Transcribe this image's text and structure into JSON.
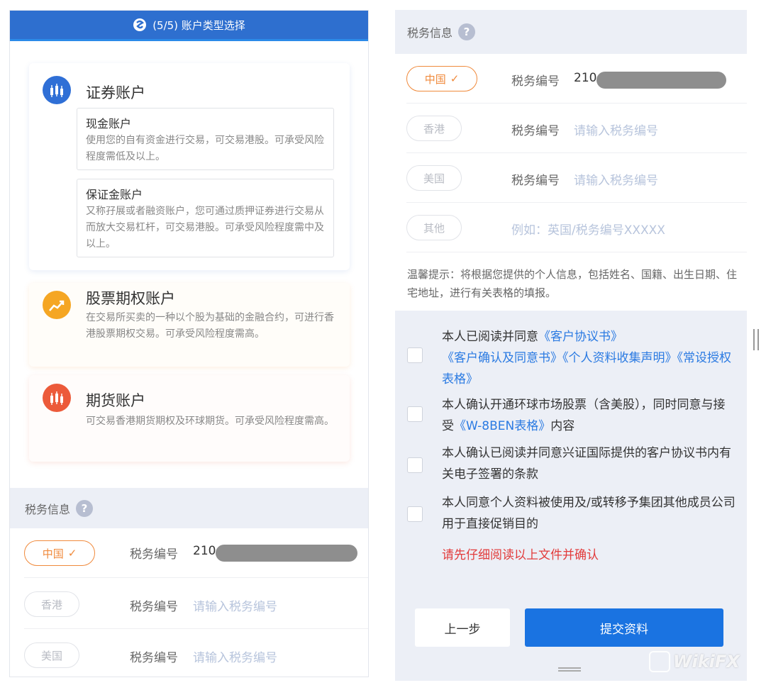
{
  "header": {
    "title": "(5/5) 账户类型选择"
  },
  "accounts": {
    "securities": {
      "title": "证券账户",
      "cash": {
        "title": "现金账户",
        "desc": "使用您的自有资金进行交易，可交易港股。可承受风险程度需低及以上。"
      },
      "margin": {
        "title": "保证金账户",
        "desc": "又称孖展或者融资账户，您可通过质押证券进行交易从而放大交易杠杆，可交易港股。可承受风险程度需中及以上。"
      }
    },
    "options": {
      "title": "股票期权账户",
      "desc": "在交易所买卖的一种以个股为基础的金融合约，可进行香港股票期权交易。可承受风险程度需高。"
    },
    "futures": {
      "title": "期货账户",
      "desc": "可交易香港期货期权及环球期货。可承受风险程度需高。"
    }
  },
  "tax": {
    "section_title": "税务信息",
    "help_symbol": "?",
    "field_label": "税务编号",
    "rows": [
      {
        "region": "中国",
        "check": "✓",
        "value": "210"
      },
      {
        "region": "香港",
        "placeholder": "请输入税务编号"
      },
      {
        "region": "美国",
        "placeholder": "请输入税务编号"
      },
      {
        "region": "其他",
        "placeholder": "例如：英国/税务编号XXXXX"
      }
    ],
    "notice": "温馨提示：将根据您提供的个人信息，包括姓名、国籍、出生日期、住宅地址，进行有关表格的填报。"
  },
  "agreements": {
    "item1": {
      "prefix": "本人已阅读并同意",
      "link1": "《客户协议书》",
      "link2": "《客户确认及同意书》",
      "link3": "《个人资料收集声明》",
      "link4": "《常设授权表格》"
    },
    "item2": {
      "prefix": "本人确认开通环球市场股票（含美股），同时同意与接受",
      "link": "《W-8BEN表格》",
      "suffix": "内容"
    },
    "item3": {
      "text": "本人确认已阅读并同意兴证国际提供的客户协议书内有关电子签署的条款"
    },
    "item4": {
      "text": "本人同意个人资料被使用及/或转移予集团其他成员公司用于直接促销目的"
    },
    "warning": "请先仔细阅读以上文件并确认"
  },
  "buttons": {
    "prev": "上一步",
    "submit": "提交资料"
  },
  "watermark": {
    "text": "WikiFX"
  },
  "colors": {
    "header": "#2e6fcf",
    "accent_orange": "#f08a3c",
    "link": "#2a7ae2",
    "warn": "#e23b3b",
    "submit": "#1a73e1"
  }
}
